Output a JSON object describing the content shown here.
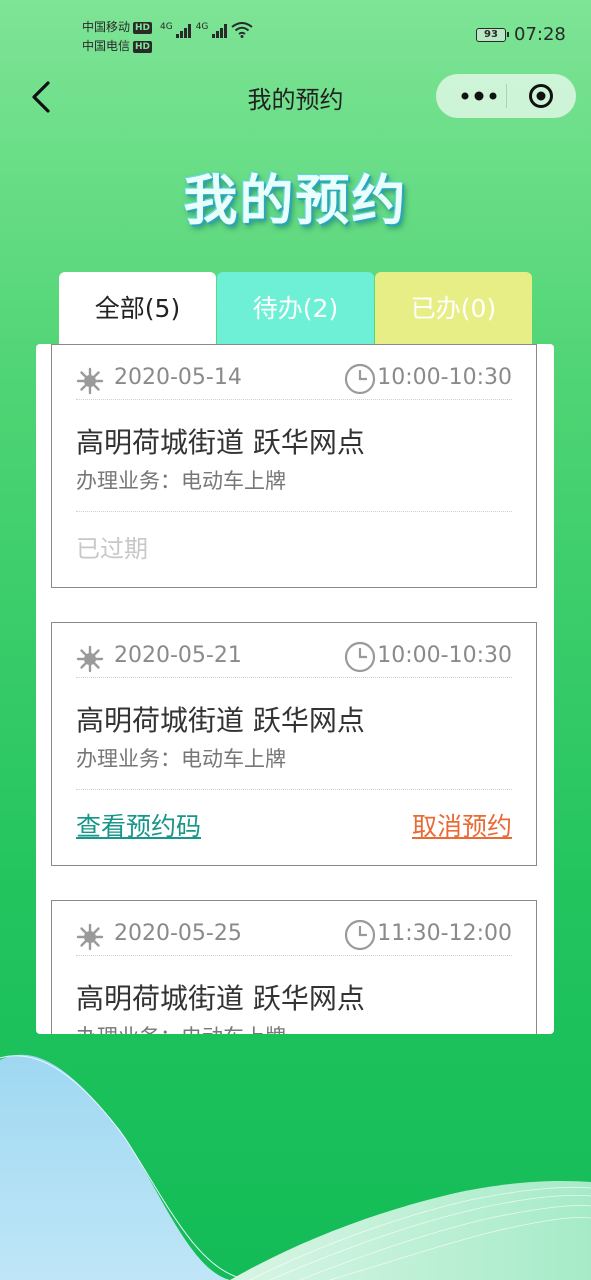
{
  "status_bar": {
    "carrier1": "中国移动",
    "carrier2": "中国电信",
    "hd": "HD",
    "net": "4G",
    "battery": "93",
    "time": "07:28"
  },
  "nav": {
    "title": "我的预约"
  },
  "hero_title": "我的预约",
  "tabs": [
    {
      "label": "全部(5)",
      "color": "#ffffff"
    },
    {
      "label": "待办(2)",
      "color": "#6ef0d6"
    },
    {
      "label": "已办(0)",
      "color": "#e7ee86"
    }
  ],
  "appointments": [
    {
      "date": "2020-05-14",
      "time": "10:00-10:30",
      "branch": "高明荷城街道 跃华网点",
      "business": "办理业务：电动车上牌",
      "status": "已过期"
    },
    {
      "date": "2020-05-21",
      "time": "10:00-10:30",
      "branch": "高明荷城街道 跃华网点",
      "business": "办理业务：电动车上牌",
      "view_label": "查看预约码",
      "cancel_label": "取消预约"
    },
    {
      "date": "2020-05-25",
      "time": "11:30-12:00",
      "branch": "高明荷城街道 跃华网点",
      "business": "办理业务：电动车上牌"
    }
  ],
  "colors": {
    "accent_link": "#17968a",
    "cancel_link": "#ea6a35",
    "bg_green": "#22c45e"
  },
  "icons": [
    "back-arrow-icon",
    "more-dots-icon",
    "target-circle-icon",
    "sun-icon",
    "clock-icon"
  ]
}
